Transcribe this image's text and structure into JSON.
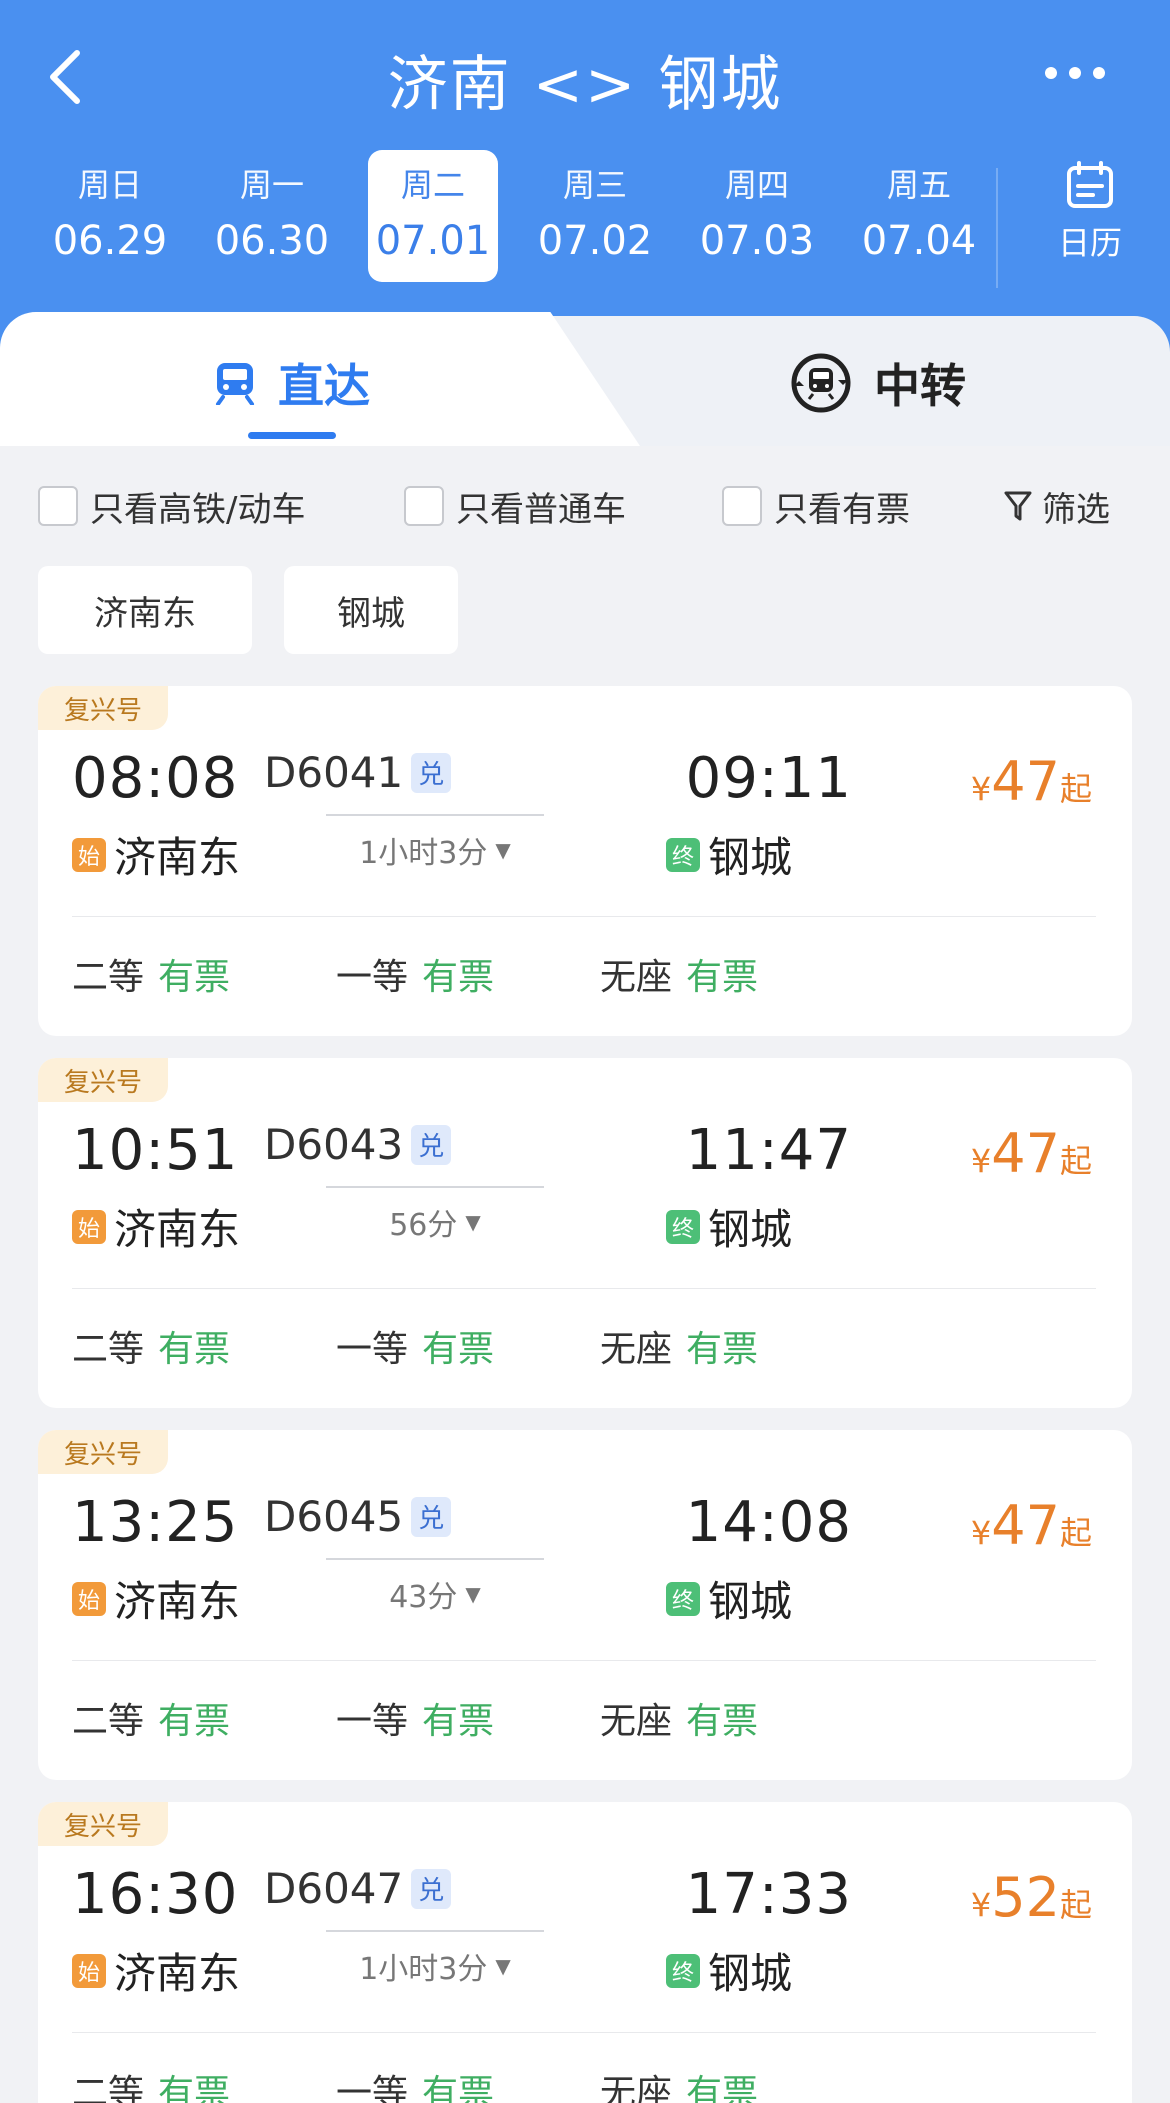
{
  "header": {
    "title": "济南 <> 钢城",
    "dates": [
      {
        "weekday": "周日",
        "date": "06.29"
      },
      {
        "weekday": "周一",
        "date": "06.30"
      },
      {
        "weekday": "周二",
        "date": "07.01"
      },
      {
        "weekday": "周三",
        "date": "07.02"
      },
      {
        "weekday": "周四",
        "date": "07.03"
      },
      {
        "weekday": "周五",
        "date": "07.04"
      }
    ],
    "calendar_label": "日历"
  },
  "tabs": {
    "direct": "直达",
    "transfer": "中转"
  },
  "filters": {
    "high_speed_only": "只看高铁/动车",
    "regular_only": "只看普通车",
    "available_only": "只看有票",
    "filter": "筛选"
  },
  "stations": [
    "济南东",
    "钢城"
  ],
  "labels": {
    "start_tag": "始",
    "end_tag": "终",
    "dui_tag": "兑",
    "yen": "¥",
    "qi": "起",
    "second_class": "二等",
    "first_class": "一等",
    "no_seat": "无座",
    "available": "有票"
  },
  "trains": [
    {
      "badge": "复兴号",
      "dep_time": "08:08",
      "dep_station": "济南东",
      "train_no": "D6041",
      "duration": "1小时3分",
      "arr_time": "09:11",
      "arr_station": "钢城",
      "price": "47"
    },
    {
      "badge": "复兴号",
      "dep_time": "10:51",
      "dep_station": "济南东",
      "train_no": "D6043",
      "duration": "56分",
      "arr_time": "11:47",
      "arr_station": "钢城",
      "price": "47"
    },
    {
      "badge": "复兴号",
      "dep_time": "13:25",
      "dep_station": "济南东",
      "train_no": "D6045",
      "duration": "43分",
      "arr_time": "14:08",
      "arr_station": "钢城",
      "price": "47"
    },
    {
      "badge": "复兴号",
      "dep_time": "16:30",
      "dep_station": "济南东",
      "train_no": "D6047",
      "duration": "1小时3分",
      "arr_time": "17:33",
      "arr_station": "钢城",
      "price": "52"
    }
  ],
  "colors": {
    "header_blue": "#4a90f0",
    "active_blue": "#2f7cf0",
    "price_orange": "#e8802b",
    "available_green": "#3fae62"
  }
}
